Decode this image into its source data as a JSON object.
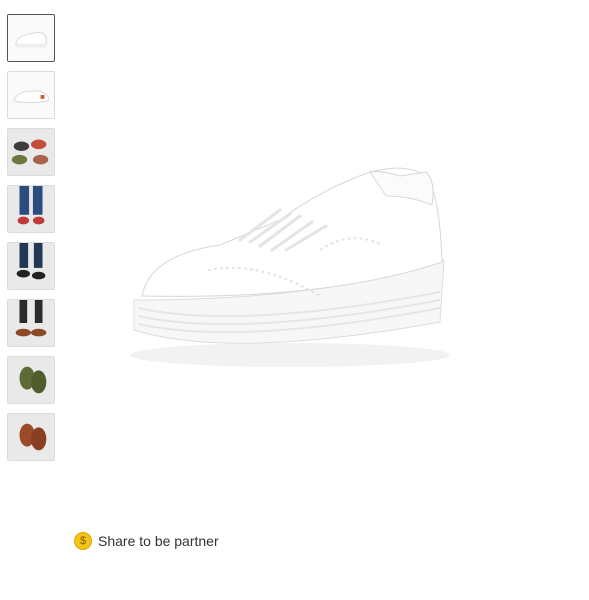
{
  "gallery": {
    "thumbnails": [
      {
        "name": "white-sneaker-side",
        "active": true
      },
      {
        "name": "white-sneaker-top"
      },
      {
        "name": "color-variants-grid"
      },
      {
        "name": "model-wearing-jeans"
      },
      {
        "name": "model-black-shoes"
      },
      {
        "name": "model-brown-shoes"
      },
      {
        "name": "green-shoes"
      },
      {
        "name": "brown-shoes"
      }
    ]
  },
  "share": {
    "label": "Share to be partner",
    "icon": "coin-icon",
    "icon_symbol": "$"
  }
}
